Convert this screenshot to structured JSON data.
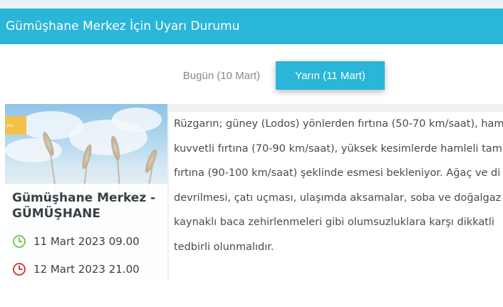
{
  "header": {
    "title": "Gümüşhane Merkez İçin Uyarı Durumu"
  },
  "tabs": [
    {
      "label": "Bugün (10 Mart)",
      "active": false
    },
    {
      "label": "Yarın (11 Mart)",
      "active": true
    }
  ],
  "card": {
    "tag_icon": "warning-tag-icon",
    "title": "Gümüşhane Merkez - GÜMÜŞHANE",
    "start_label": "11 Mart 2023 09.00",
    "end_label": "12 Mart 2023 21.00",
    "start_icon": "clock-icon",
    "end_icon": "clock-icon"
  },
  "description": {
    "lines": [
      "Rüzgarın; güney (Lodos) yönlerden fırtına (50-70 km/saat), ham",
      "kuvvetli fırtına (70-90 km/saat), yüksek kesimlerde hamleli tam",
      "fırtına (90-100 km/saat) şeklinde esmesi bekleniyor. Ağaç ve di",
      "devrilmesi, çatı uçması, ulaşımda aksamalar, soba ve doğalgaz",
      "kaynaklı baca zehirlenmeleri gibi olumsuzluklara karşı dikkatli",
      "tedbirli olunmalıdır."
    ]
  },
  "colors": {
    "accent": "#29b6d8",
    "start_clock": "#6cc04a",
    "end_clock": "#d0312d",
    "warning": "#f3c14a"
  }
}
